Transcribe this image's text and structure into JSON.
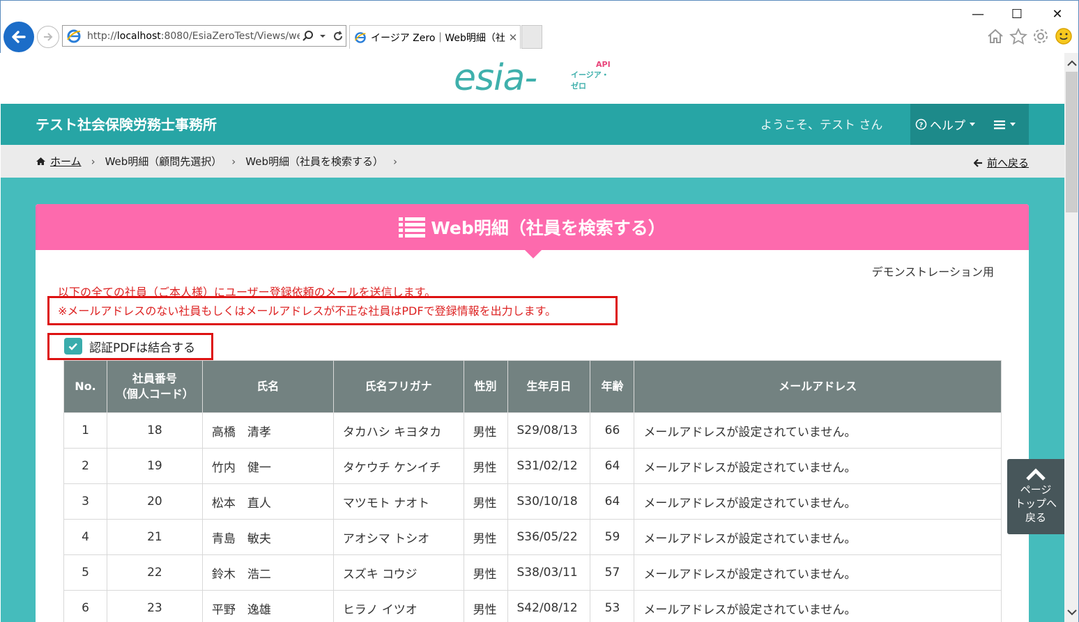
{
  "browser": {
    "url_prefix": "http://",
    "url_host": "localhost",
    "url_rest": ":8080/EsiaZeroTest/Views/we",
    "tab_title": "イージア Zero｜Web明細（社...",
    "window_controls": {
      "minimize": "—",
      "maximize": "☐",
      "close": "✕"
    }
  },
  "site": {
    "logo_text": "esia-Zero",
    "logo_api": "API",
    "logo_kana": "イージア・ゼロ",
    "office_name": "テスト社会保険労務士事務所",
    "welcome": "ようこそ、テスト さん",
    "help_label": "ヘルプ",
    "accent_color": "#27a5a5",
    "header_color": "#fd6aad"
  },
  "breadcrumb": {
    "home": "ホーム",
    "step1": "Web明細（顧問先選択）",
    "step2": "Web明細（社員を検索する）",
    "back": "前へ戻る"
  },
  "card": {
    "title": "Web明細（社員を検索する）",
    "demo_label": "デモンストレーション用",
    "notice1": "以下の全ての社員（ご本人様）にユーザー登録依頼のメールを送信します。",
    "notice2": "※メールアドレスのない社員もしくはメールアドレスが不正な社員はPDFで登録情報を出力します。",
    "checkbox_label": "認証PDFは結合する",
    "checkbox_checked": true
  },
  "table": {
    "headers": {
      "no": "No.",
      "emp_no_line1": "社員番号",
      "emp_no_line2": "（個人コード）",
      "name": "氏名",
      "furigana": "氏名フリガナ",
      "gender": "性別",
      "birthday": "生年月日",
      "age": "年齢",
      "email": "メールアドレス"
    },
    "rows": [
      {
        "no": "1",
        "emp_no": "18",
        "name": "高橋　清孝",
        "furigana": "タカハシ キヨタカ",
        "gender": "男性",
        "birthday": "S29/08/13",
        "age": "66",
        "email": "メールアドレスが設定されていません。"
      },
      {
        "no": "2",
        "emp_no": "19",
        "name": "竹内　健一",
        "furigana": "タケウチ ケンイチ",
        "gender": "男性",
        "birthday": "S31/02/12",
        "age": "64",
        "email": "メールアドレスが設定されていません。"
      },
      {
        "no": "3",
        "emp_no": "20",
        "name": "松本　直人",
        "furigana": "マツモト ナオト",
        "gender": "男性",
        "birthday": "S30/10/18",
        "age": "64",
        "email": "メールアドレスが設定されていません。"
      },
      {
        "no": "4",
        "emp_no": "21",
        "name": "青島　敏夫",
        "furigana": "アオシマ トシオ",
        "gender": "男性",
        "birthday": "S36/05/22",
        "age": "59",
        "email": "メールアドレスが設定されていません。"
      },
      {
        "no": "5",
        "emp_no": "22",
        "name": "鈴木　浩二",
        "furigana": "スズキ コウジ",
        "gender": "男性",
        "birthday": "S38/03/11",
        "age": "57",
        "email": "メールアドレスが設定されていません。"
      },
      {
        "no": "6",
        "emp_no": "23",
        "name": "平野　逸雄",
        "furigana": "ヒラノ イツオ",
        "gender": "男性",
        "birthday": "S42/08/12",
        "age": "53",
        "email": "メールアドレスが設定されていません。"
      }
    ]
  },
  "page_top": {
    "line1": "ページ",
    "line2": "トップへ",
    "line3": "戻る"
  }
}
